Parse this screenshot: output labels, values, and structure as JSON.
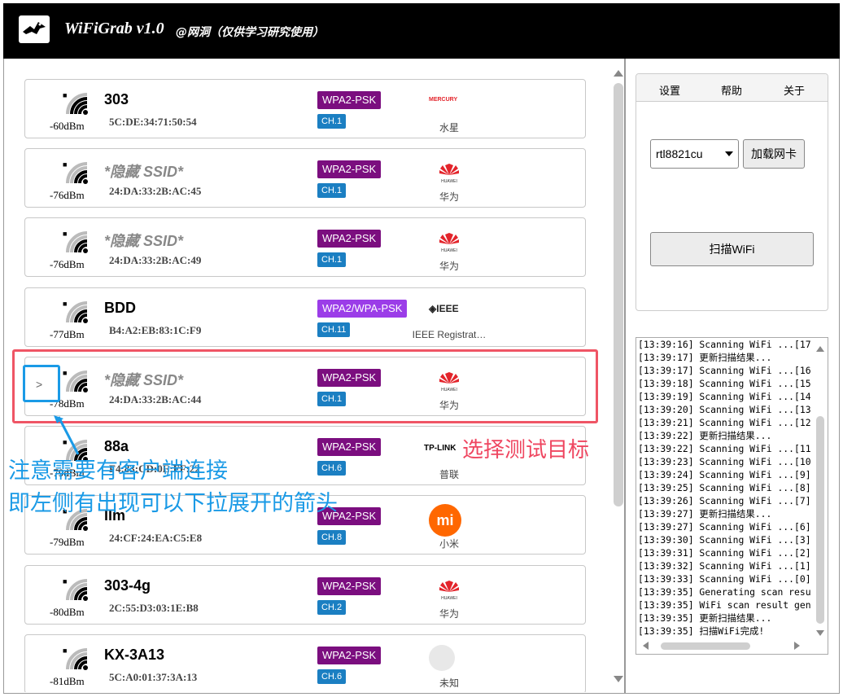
{
  "app": {
    "title": "WiFiGrab v1.0",
    "subtitle": "@网洞（仅供学习研究使用）",
    "logo": "bird-logo-icon"
  },
  "networks": [
    {
      "ssid": "303",
      "hidden": false,
      "dbm": "-60dBm",
      "mac": "5C:DE:34:71:50:54",
      "security": "WPA2-PSK",
      "channel": "CH.1",
      "brand_text": "MERCURY",
      "vendor": "水星",
      "signal": 4
    },
    {
      "ssid": "*隐藏 SSID*",
      "hidden": true,
      "dbm": "-76dBm",
      "mac": "24:DA:33:2B:AC:45",
      "security": "WPA2-PSK",
      "channel": "CH.1",
      "brand_text": "HUAWEI",
      "vendor": "华为",
      "signal": 3
    },
    {
      "ssid": "*隐藏 SSID*",
      "hidden": true,
      "dbm": "-76dBm",
      "mac": "24:DA:33:2B:AC:49",
      "security": "WPA2-PSK",
      "channel": "CH.1",
      "brand_text": "HUAWEI",
      "vendor": "华为",
      "signal": 3
    },
    {
      "ssid": "BDD",
      "hidden": false,
      "dbm": "-77dBm",
      "mac": "B4:A2:EB:83:1C:F9",
      "security": "WPA2/WPA-PSK",
      "channel": "CH.11",
      "brand_text": "◈IEEE",
      "vendor": "IEEE Registrat…",
      "signal": 3
    },
    {
      "ssid": "*隐藏 SSID*",
      "hidden": true,
      "dbm": "-78dBm",
      "mac": "24:DA:33:2B:AC:44",
      "security": "WPA2-PSK",
      "channel": "CH.1",
      "brand_text": "HUAWEI",
      "vendor": "华为",
      "signal": 3
    },
    {
      "ssid": "88a",
      "hidden": false,
      "dbm": "-79dBm",
      "mac": "F4:83:CD:0E:FF:22",
      "security": "WPA2-PSK",
      "channel": "CH.6",
      "brand_text": "TP-LINK",
      "vendor": "普联",
      "signal": 3
    },
    {
      "ssid": "llm",
      "hidden": false,
      "dbm": "-79dBm",
      "mac": "24:CF:24:EA:C5:E8",
      "security": "WPA2-PSK",
      "channel": "CH.8",
      "brand_text": "mi",
      "vendor": "小米",
      "signal": 3
    },
    {
      "ssid": "303-4g",
      "hidden": false,
      "dbm": "-80dBm",
      "mac": "2C:55:D3:03:1E:B8",
      "security": "WPA2-PSK",
      "channel": "CH.2",
      "brand_text": "HUAWEI",
      "vendor": "华为",
      "signal": 3
    },
    {
      "ssid": "KX-3A13",
      "hidden": false,
      "dbm": "-81dBm",
      "mac": "5C:A0:01:37:3A:13",
      "security": "WPA2-PSK",
      "channel": "CH.6",
      "brand_text": "",
      "vendor": "未知",
      "signal": 3
    }
  ],
  "menu": {
    "settings": "设置",
    "help": "帮助",
    "about": "关于"
  },
  "adapter": {
    "selected": "rtl8821cu",
    "load_label": "加载网卡"
  },
  "scan_label": "扫描WiFi",
  "log": [
    "[13:39:16] Scanning WiFi ...[17",
    "[13:39:17] 更新扫描结果...",
    "[13:39:17] Scanning WiFi ...[16",
    "[13:39:18] Scanning WiFi ...[15",
    "[13:39:19] Scanning WiFi ...[14",
    "[13:39:20] Scanning WiFi ...[13",
    "[13:39:21] Scanning WiFi ...[12",
    "[13:39:22] 更新扫描结果...",
    "[13:39:22] Scanning WiFi ...[11",
    "[13:39:23] Scanning WiFi ...[10",
    "[13:39:24] Scanning WiFi ...[9]",
    "[13:39:25] Scanning WiFi ...[8]",
    "[13:39:26] Scanning WiFi ...[7]",
    "[13:39:27] 更新扫描结果...",
    "[13:39:27] Scanning WiFi ...[6]",
    "[13:39:30] Scanning WiFi ...[3]",
    "[13:39:31] Scanning WiFi ...[2]",
    "[13:39:32] Scanning WiFi ...[1]",
    "[13:39:33] Scanning WiFi ...[0]",
    "[13:39:35] Generating scan resu",
    "[13:39:35] WiFi scan result gen",
    "[13:39:35] 更新扫描结果...",
    "[13:39:35] 扫描WiFi完成!"
  ],
  "annotations": {
    "target_label": "选择测试目标",
    "note_line1": "注意需要有客户端连接",
    "note_line2": "即左侧有出现可以下拉展开的箭头",
    "expand_arrow": ">"
  },
  "colors": {
    "wpa2_psk": "#7b0e7f",
    "wpa2_wpa_psk": "#9b3de8",
    "channel": "#1b7fc2",
    "highlight_red": "#ef5565",
    "annotation_blue": "#1a9ae6",
    "huawei_red": "#e3242b",
    "xiaomi_orange": "#ff6700"
  }
}
